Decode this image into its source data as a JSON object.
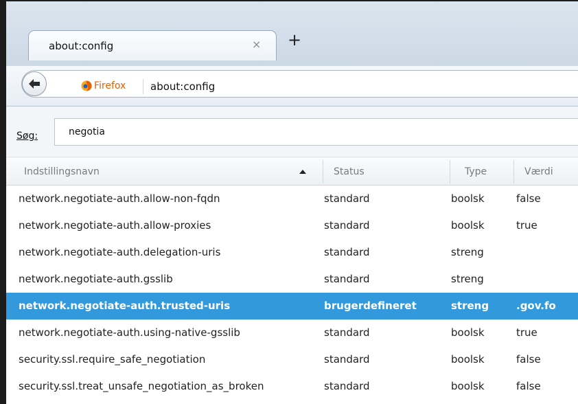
{
  "tab": {
    "title": "about:config",
    "close_glyph": "×",
    "new_tab_glyph": "+"
  },
  "navbar": {
    "identity_label": "Firefox",
    "url": "about:config"
  },
  "search": {
    "label": "Søg:",
    "value": "negotia"
  },
  "table": {
    "headers": [
      "Indstillingsnavn",
      "Status",
      "Type",
      "Værdi"
    ],
    "rows": [
      [
        "network.negotiate-auth.allow-non-fqdn",
        "standard",
        "boolsk",
        "false"
      ],
      [
        "network.negotiate-auth.allow-proxies",
        "standard",
        "boolsk",
        "true"
      ],
      [
        "network.negotiate-auth.delegation-uris",
        "standard",
        "streng",
        ""
      ],
      [
        "network.negotiate-auth.gsslib",
        "standard",
        "streng",
        ""
      ],
      [
        "network.negotiate-auth.trusted-uris",
        "brugerdefineret",
        "streng",
        ".gov.fo"
      ],
      [
        "network.negotiate-auth.using-native-gsslib",
        "standard",
        "boolsk",
        "true"
      ],
      [
        "security.ssl.require_safe_negotiation",
        "standard",
        "boolsk",
        "false"
      ],
      [
        "security.ssl.treat_unsafe_negotiation_as_broken",
        "standard",
        "boolsk",
        "false"
      ]
    ],
    "selected_row": 4
  },
  "colors": {
    "selection": "#3399dd",
    "firefox_orange": "#e66000"
  },
  "icons": {
    "back": "back-arrow-icon",
    "identity": "firefox-icon",
    "sort": "sort-ascending-icon"
  }
}
